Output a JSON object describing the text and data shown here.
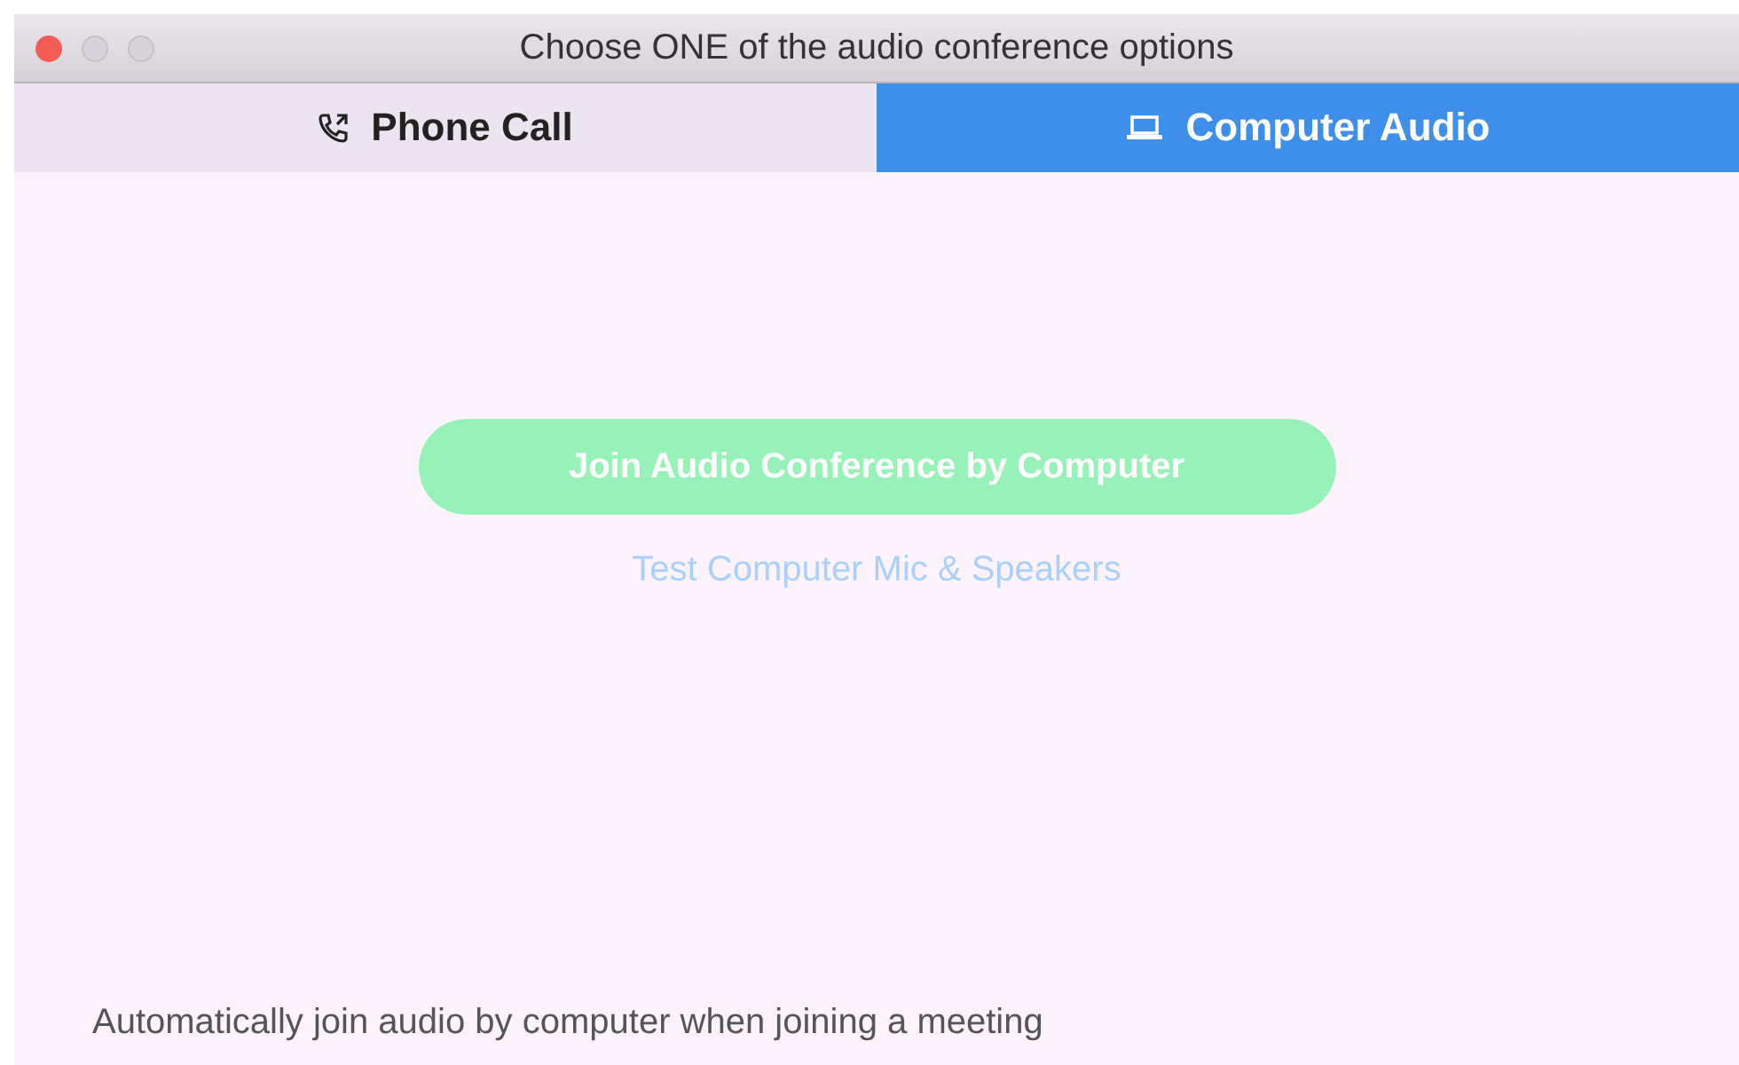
{
  "window": {
    "title": "Choose ONE of the audio conference options"
  },
  "tabs": [
    {
      "label": "Phone Call",
      "selected": false
    },
    {
      "label": "Computer Audio",
      "selected": true
    }
  ],
  "join_button": {
    "label": "Join Audio Conference by Computer"
  },
  "test_link": {
    "label": "Test Computer Mic & Speakers"
  },
  "footer": {
    "text": "Automatically join audio by computer when joining a meeting"
  }
}
